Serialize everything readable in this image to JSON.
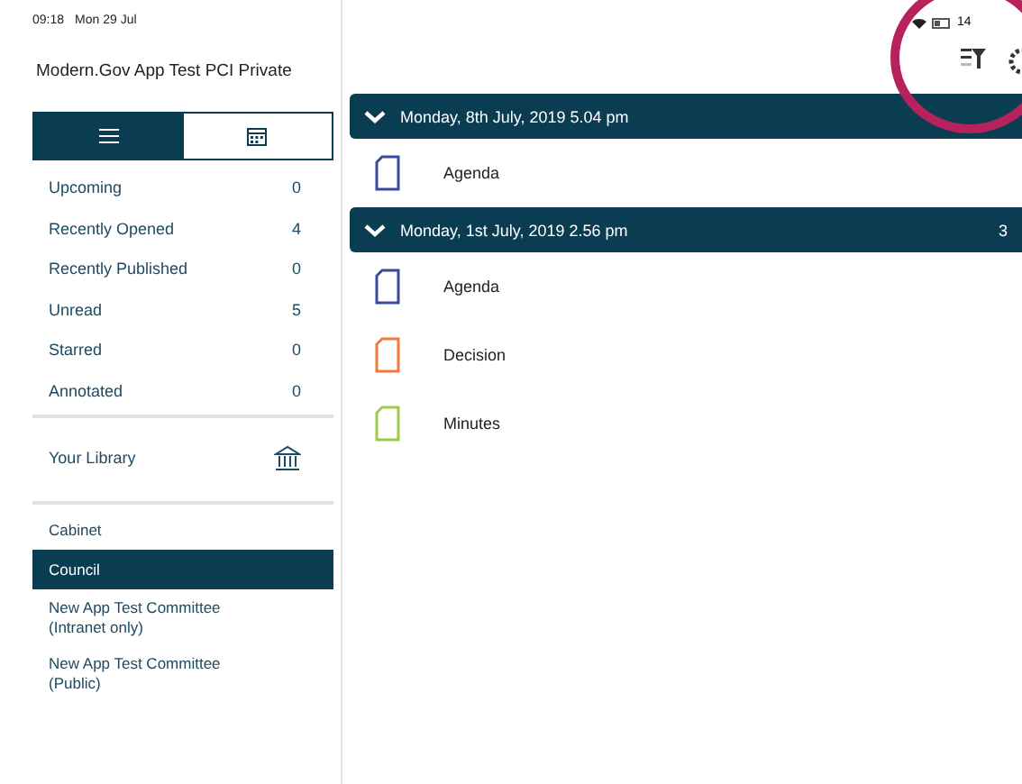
{
  "status_bar": {
    "time": "09:18",
    "date": "Mon 29 Jul",
    "battery": "14"
  },
  "sidebar": {
    "title": "Modern.Gov App Test PCI Private",
    "view_tabs": [
      {
        "kind": "list",
        "selected": true
      },
      {
        "kind": "calendar",
        "selected": false
      }
    ],
    "filters": [
      {
        "label": "Upcoming",
        "count": "0"
      },
      {
        "label": "Recently Opened",
        "count": "4"
      },
      {
        "label": "Recently Published",
        "count": "0"
      },
      {
        "label": "Unread",
        "count": "5"
      },
      {
        "label": "Starred",
        "count": "0"
      },
      {
        "label": "Annotated",
        "count": "0"
      }
    ],
    "library": {
      "label": "Your Library"
    },
    "committees": [
      {
        "label": "Cabinet",
        "selected": false
      },
      {
        "label": "Council",
        "selected": true
      },
      {
        "label": "New App Test Committee\n(Intranet only)",
        "selected": false
      },
      {
        "label": "New App Test Committee\n(Public)",
        "selected": false
      }
    ]
  },
  "meetings": [
    {
      "date": "Monday, 8th July, 2019 5.04 pm",
      "expanded": true,
      "documents": [
        {
          "name": "Agenda",
          "color": "#3a4a9c"
        }
      ]
    },
    {
      "date": "Monday, 1st July, 2019 2.56 pm",
      "count": "3",
      "expanded": true,
      "documents": [
        {
          "name": "Agenda",
          "color": "#3a4a9c"
        },
        {
          "name": "Decision",
          "color": "#f07a3c"
        },
        {
          "name": "Minutes",
          "color": "#9ccc4a"
        }
      ]
    }
  ]
}
